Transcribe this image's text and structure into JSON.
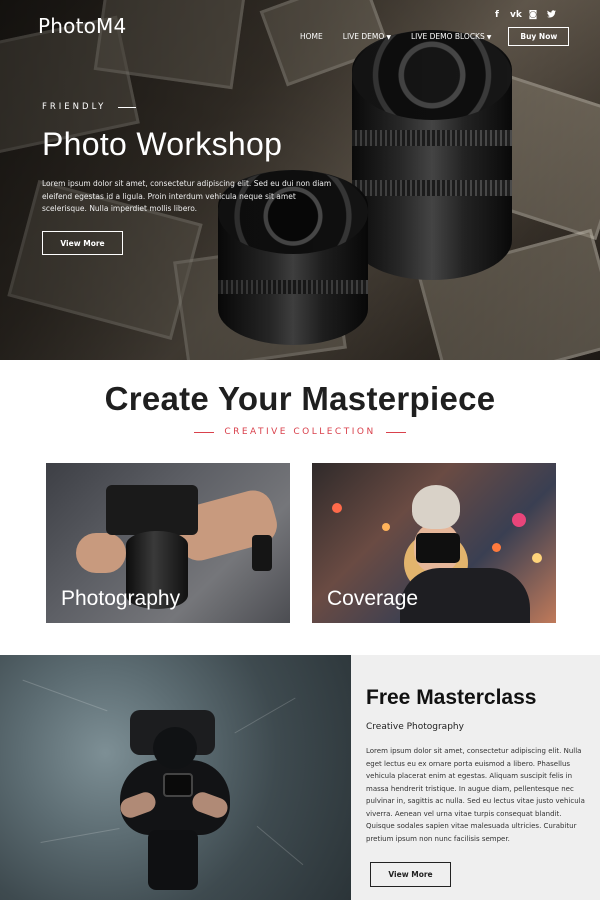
{
  "header": {
    "logo": "PhotoM4",
    "social": [
      {
        "icon": "facebook-icon",
        "glyph": "f"
      },
      {
        "icon": "vk-icon",
        "glyph": "vk"
      },
      {
        "icon": "instagram-icon",
        "glyph": "◙"
      },
      {
        "icon": "twitter-icon",
        "glyph": "🐦"
      }
    ],
    "nav": [
      {
        "label": "HOME",
        "dropdown": false
      },
      {
        "label": "LIVE DEMO",
        "dropdown": true
      },
      {
        "label": "LIVE DEMO BLOCKS",
        "dropdown": true
      }
    ],
    "buy_label": "Buy Now"
  },
  "hero": {
    "kicker": "FRIENDLY",
    "title": "Photo Workshop",
    "text": "Lorem ipsum dolor sit amet, consectetur adipiscing elit. Sed eu dui non diam eleifend egestas id a ligula. Proin interdum vehicula neque sit amet scelerisque. Nulla imperdiet mollis libero.",
    "button": "View More"
  },
  "masterpiece": {
    "title": "Create Your Masterpiece",
    "subtitle": "CREATIVE COLLECTION",
    "cards": [
      {
        "label": "Photography"
      },
      {
        "label": "Coverage"
      }
    ]
  },
  "masterclass": {
    "title": "Free Masterclass",
    "subtitle": "Creative Photography",
    "text": "Lorem ipsum dolor sit amet, consectetur adipiscing elit. Nulla eget lectus eu ex ornare porta euismod a libero. Phasellus vehicula placerat enim at egestas. Aliquam suscipit felis in massa hendrerit tristique. In augue diam, pellentesque nec pulvinar in, sagittis ac nulla. Sed eu lectus vitae justo vehicula viverra. Aenean vel urna vitae turpis consequat blandit. Quisque sodales sapien vitae malesuada ultricies. Curabitur pretium ipsum non nunc facilisis semper.",
    "button": "View More"
  },
  "colors": {
    "accent": "#d9414c",
    "panel_bg": "#efefef",
    "text_dark": "#1f1f1f"
  }
}
